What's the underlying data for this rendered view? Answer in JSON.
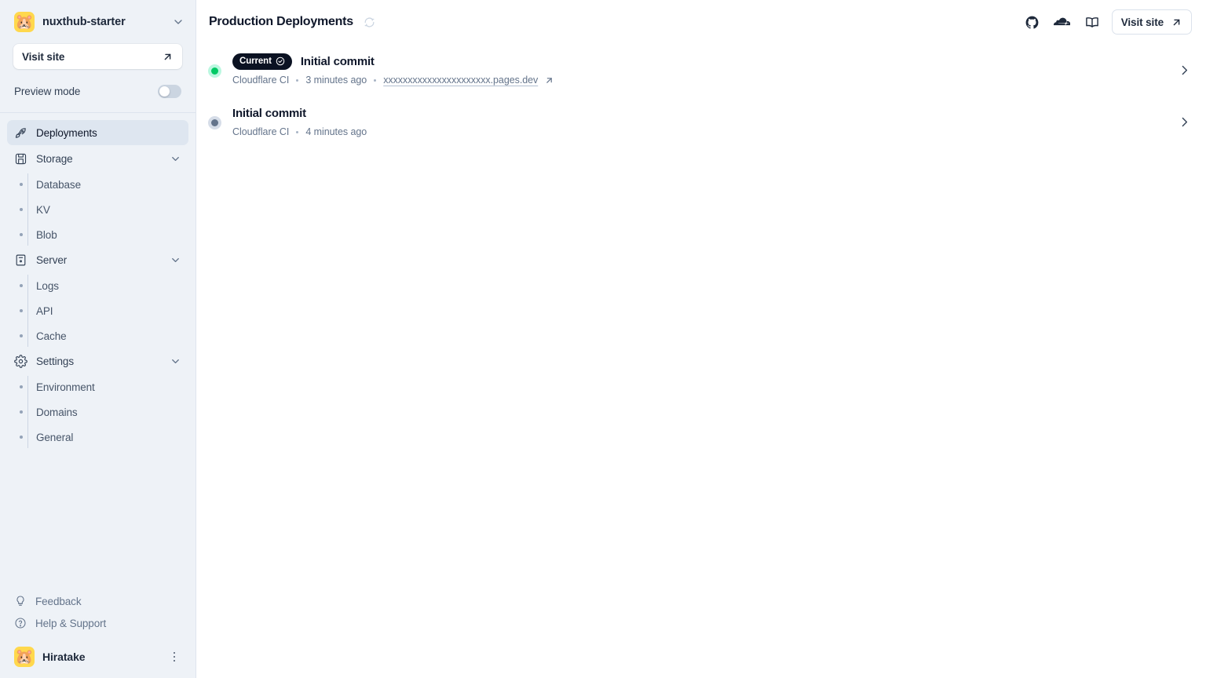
{
  "sidebar": {
    "team": {
      "avatar_emoji": "🐹",
      "name": "nuxthub-starter",
      "chevron_icon": "chevron-down-icon"
    },
    "visit_site": {
      "label": "Visit site",
      "icon": "arrow-up-right-icon"
    },
    "preview_mode": {
      "label": "Preview mode",
      "enabled": false
    },
    "nav": [
      {
        "label": "Deployments",
        "icon": "rocket-icon",
        "active": true,
        "expandable": false
      },
      {
        "label": "Storage",
        "icon": "database-save-icon",
        "active": false,
        "expandable": true,
        "children": [
          {
            "label": "Database"
          },
          {
            "label": "KV"
          },
          {
            "label": "Blob"
          }
        ]
      },
      {
        "label": "Server",
        "icon": "server-icon",
        "active": false,
        "expandable": true,
        "children": [
          {
            "label": "Logs"
          },
          {
            "label": "API"
          },
          {
            "label": "Cache"
          }
        ]
      },
      {
        "label": "Settings",
        "icon": "gear-icon",
        "active": false,
        "expandable": true,
        "children": [
          {
            "label": "Environment"
          },
          {
            "label": "Domains"
          },
          {
            "label": "General"
          }
        ]
      }
    ],
    "footer": [
      {
        "label": "Feedback",
        "icon": "lightbulb-icon"
      },
      {
        "label": "Help & Support",
        "icon": "question-circle-icon"
      }
    ],
    "user": {
      "avatar_emoji": "🐹",
      "name": "Hiratake",
      "menu_icon": "kebab-menu-icon"
    }
  },
  "header": {
    "title": "Production Deployments",
    "refresh_icon": "refresh-icon",
    "actions": [
      {
        "name": "github-icon"
      },
      {
        "name": "cloudflare-icon"
      },
      {
        "name": "book-docs-icon"
      }
    ],
    "visit_site": {
      "label": "Visit site",
      "icon": "arrow-up-right-icon"
    }
  },
  "deployments": [
    {
      "status": "green",
      "badge": "Current",
      "badge_icon": "check-circle-icon",
      "title": "Initial commit",
      "source": "Cloudflare CI",
      "time": "3 minutes ago",
      "url": "xxxxxxxxxxxxxxxxxxxxxx.pages.dev",
      "url_icon": "arrow-up-right-icon",
      "chevron": "chevron-right-icon"
    },
    {
      "status": "gray",
      "badge": null,
      "title": "Initial commit",
      "source": "Cloudflare CI",
      "time": "4 minutes ago",
      "url": null,
      "chevron": "chevron-right-icon"
    }
  ],
  "colors": {
    "sidebar_bg": "#eef2f7",
    "accent_green": "#00c964",
    "badge_bg": "#0b1222",
    "text_primary": "#0f172a",
    "text_muted": "#64748b"
  }
}
